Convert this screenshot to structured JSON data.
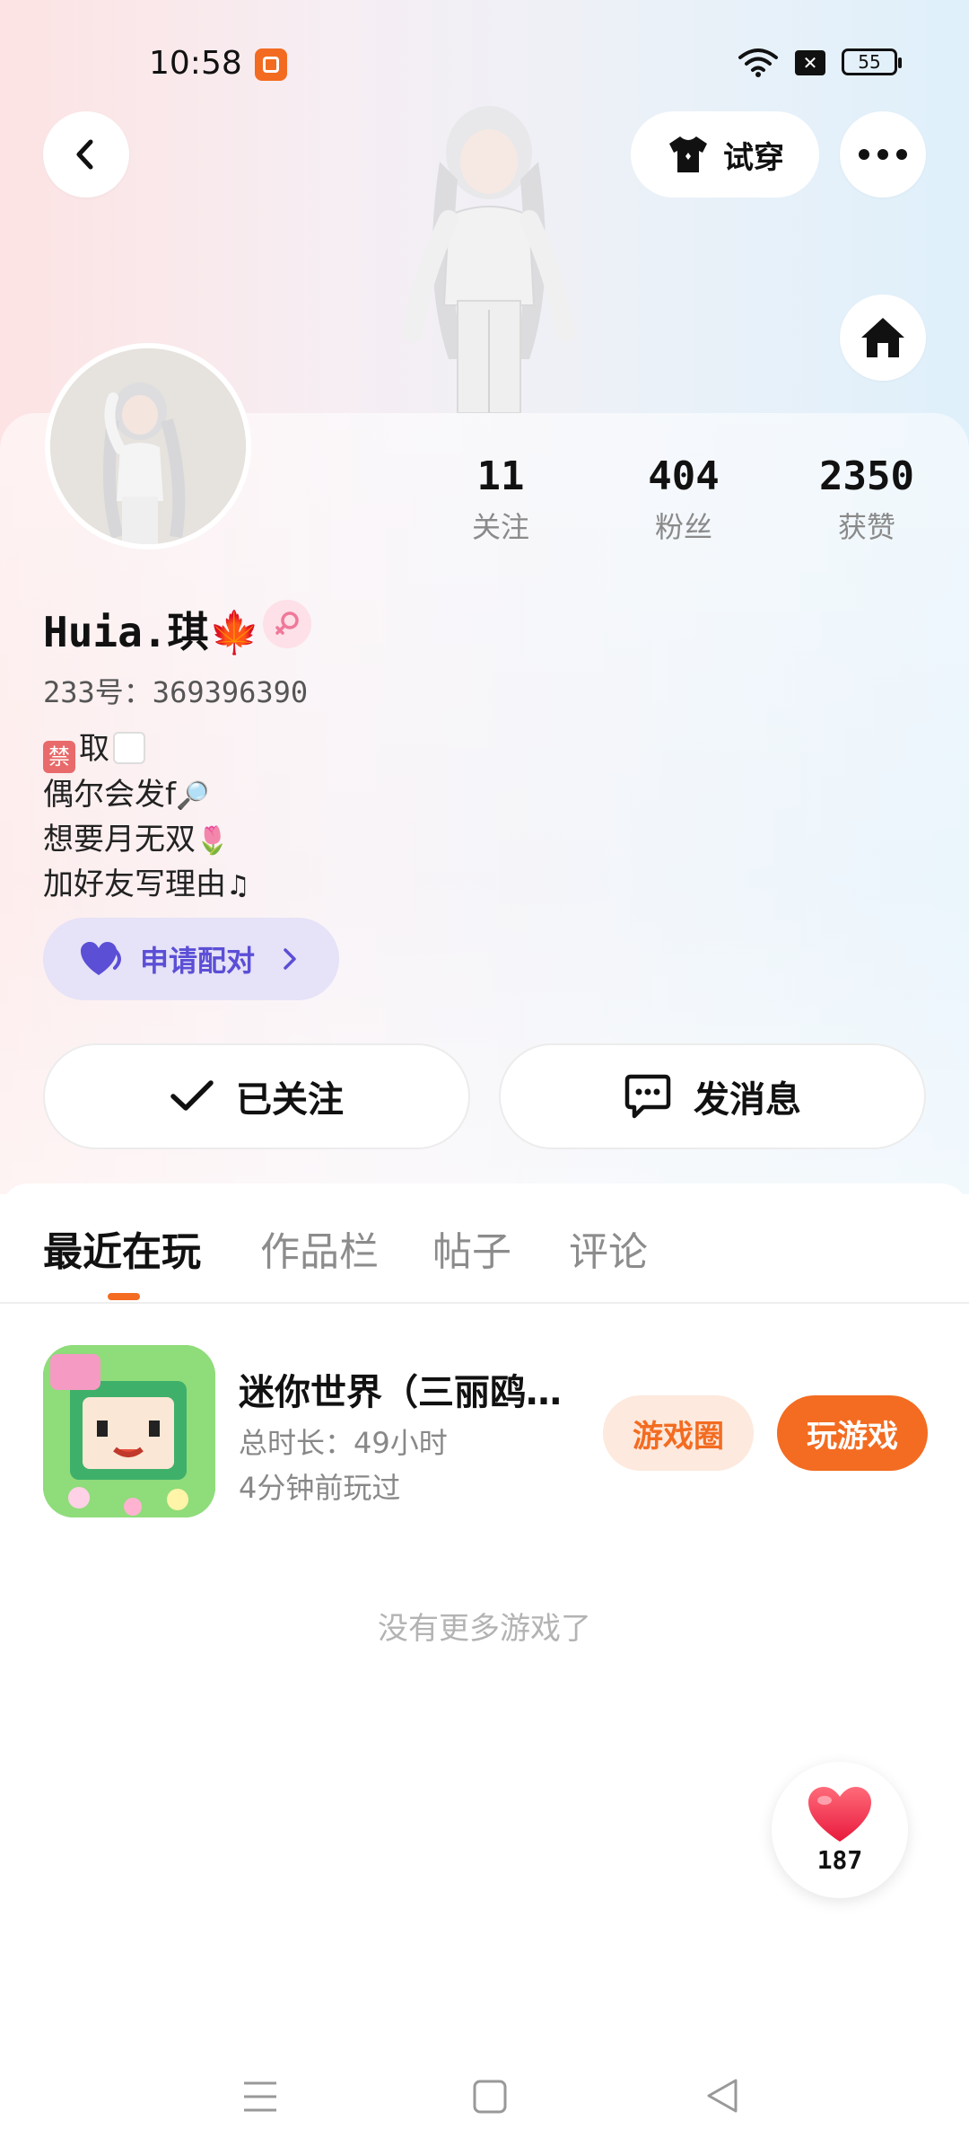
{
  "status_bar": {
    "time": "10:58",
    "battery": "55"
  },
  "top_actions": {
    "try_on_label": "试穿"
  },
  "profile": {
    "stats": [
      {
        "value": "11",
        "label": "关注"
      },
      {
        "value": "404",
        "label": "粉丝"
      },
      {
        "value": "2350",
        "label": "获赞"
      }
    ],
    "name": "Huia.琪🍁",
    "id_line": "233号：369396390",
    "bio": [
      "取",
      "偶尔会发f",
      "想要月无双",
      "加好友写理由"
    ],
    "match_label": "申请配对",
    "follow_label": "已关注",
    "message_label": "发消息"
  },
  "tabs": [
    "最近在玩",
    "作品栏",
    "帖子",
    "评论"
  ],
  "games": [
    {
      "title": "迷你世界（三丽鸥…",
      "total_time": "总时长：49小时",
      "last_played": "4分钟前玩过",
      "circle_label": "游戏圈",
      "play_label": "玩游戏"
    }
  ],
  "no_more_text": "没有更多游戏了",
  "likes": {
    "count": "187"
  },
  "colors": {
    "accent": "#f36c21",
    "match_purple": "#5b4fd6"
  }
}
